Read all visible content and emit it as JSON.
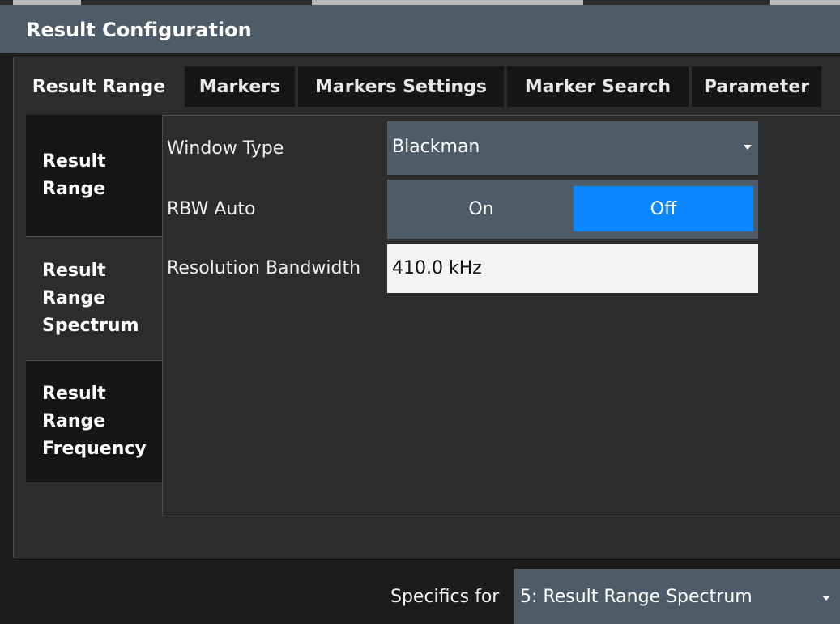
{
  "dialog": {
    "title": "Result Configuration"
  },
  "tabs": [
    {
      "label": "Result Range",
      "active": true
    },
    {
      "label": "Markers",
      "active": false
    },
    {
      "label": "Markers Settings",
      "active": false
    },
    {
      "label": "Marker Search",
      "active": false
    },
    {
      "label": "Parameter",
      "active": false
    }
  ],
  "sidebar": {
    "items": [
      {
        "lines": [
          "Result",
          "Range"
        ],
        "active": false
      },
      {
        "lines": [
          "Result",
          "Range",
          "Spectrum"
        ],
        "active": true
      },
      {
        "lines": [
          "Result",
          "Range",
          "Frequency"
        ],
        "active": false
      }
    ]
  },
  "form": {
    "window_type": {
      "label": "Window Type",
      "value": "Blackman",
      "icon": "chevron-down-icon"
    },
    "rbw_auto": {
      "label": "RBW Auto",
      "on_label": "On",
      "off_label": "Off",
      "selected": "Off"
    },
    "resolution_bandwidth": {
      "label": "Resolution Bandwidth",
      "value": "410.0 kHz"
    }
  },
  "footer": {
    "specifics_label": "Specifics for",
    "specifics_value": "5: Result Range Spectrum",
    "icon": "chevron-down-icon"
  },
  "colors": {
    "accent": "#0a86ff",
    "panel": "#4e5b68",
    "background": "#2c2c2c",
    "dark": "#161616"
  }
}
